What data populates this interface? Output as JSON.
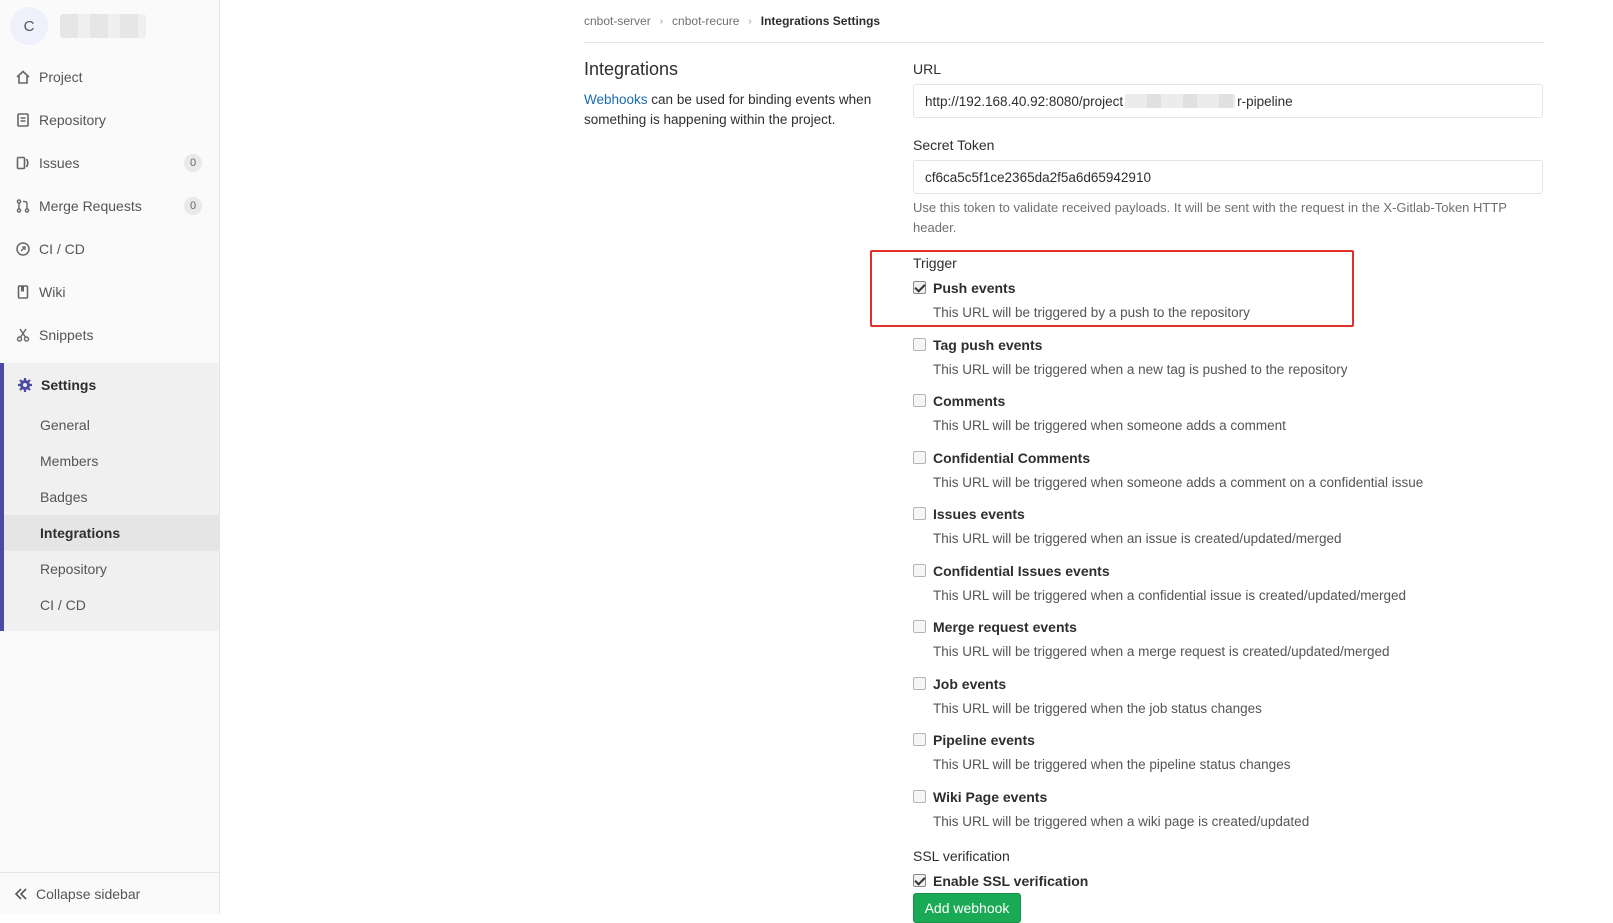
{
  "sidebar": {
    "avatar_letter": "C",
    "nav": [
      {
        "label": "Project",
        "icon": "home-icon"
      },
      {
        "label": "Repository",
        "icon": "document-icon"
      },
      {
        "label": "Issues",
        "icon": "issues-icon",
        "count": "0"
      },
      {
        "label": "Merge Requests",
        "icon": "merge-request-icon",
        "count": "0"
      },
      {
        "label": "CI / CD",
        "icon": "rocket-icon"
      },
      {
        "label": "Wiki",
        "icon": "book-icon"
      },
      {
        "label": "Snippets",
        "icon": "scissors-icon"
      }
    ],
    "settings": {
      "label": "Settings",
      "icon": "gear-icon",
      "items": [
        "General",
        "Members",
        "Badges",
        "Integrations",
        "Repository",
        "CI / CD"
      ],
      "active": "Integrations"
    },
    "collapse_label": "Collapse sidebar"
  },
  "breadcrumb": {
    "items": [
      "cnbot-server",
      "cnbot-recure",
      "Integrations Settings"
    ]
  },
  "intro": {
    "title": "Integrations",
    "link_text": "Webhooks",
    "text": " can be used for binding events when something is happening within the project."
  },
  "form": {
    "url_label": "URL",
    "url_value_start": "http://192.168.40.92:8080/project",
    "url_value_end": "r-pipeline",
    "token_label": "Secret Token",
    "token_value": "cf6ca5c5f1ce2365da2f5a6d65942910",
    "token_help": "Use this token to validate received payloads. It will be sent with the request in the X-Gitlab-Token HTTP header.",
    "trigger_label": "Trigger",
    "triggers": [
      {
        "title": "Push events",
        "desc": "This URL will be triggered by a push to the repository",
        "checked": true
      },
      {
        "title": "Tag push events",
        "desc": "This URL will be triggered when a new tag is pushed to the repository",
        "checked": false
      },
      {
        "title": "Comments",
        "desc": "This URL will be triggered when someone adds a comment",
        "checked": false
      },
      {
        "title": "Confidential Comments",
        "desc": "This URL will be triggered when someone adds a comment on a confidential issue",
        "checked": false
      },
      {
        "title": "Issues events",
        "desc": "This URL will be triggered when an issue is created/updated/merged",
        "checked": false
      },
      {
        "title": "Confidential Issues events",
        "desc": "This URL will be triggered when a confidential issue is created/updated/merged",
        "checked": false
      },
      {
        "title": "Merge request events",
        "desc": "This URL will be triggered when a merge request is created/updated/merged",
        "checked": false
      },
      {
        "title": "Job events",
        "desc": "This URL will be triggered when the job status changes",
        "checked": false
      },
      {
        "title": "Pipeline events",
        "desc": "This URL will be triggered when the pipeline status changes",
        "checked": false
      },
      {
        "title": "Wiki Page events",
        "desc": "This URL will be triggered when a wiki page is created/updated",
        "checked": false
      }
    ],
    "ssl_label": "SSL verification",
    "ssl_option": "Enable SSL verification",
    "ssl_checked": true,
    "submit_label": "Add webhook"
  },
  "colors": {
    "accent": "#4b4ba3",
    "link": "#1b69b6",
    "submit": "#1aaa55",
    "highlight_box": "#e0312b"
  }
}
